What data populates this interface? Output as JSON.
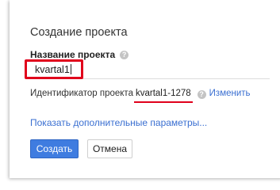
{
  "dialog": {
    "title": "Создание проекта",
    "name_field": {
      "label": "Название проекта",
      "value": "kvartal1"
    },
    "project_id": {
      "label": "Идентификатор проекта",
      "value": "kvartal1-1278",
      "change_link": "Изменить"
    },
    "more_options_link": "Показать дополнительные параметры...",
    "buttons": {
      "create": "Создать",
      "cancel": "Отмена"
    },
    "help_icon_glyph": "?"
  },
  "colors": {
    "accent": "#3f7ce0",
    "link": "#3a6fd1",
    "annotation": "#e0001b"
  }
}
